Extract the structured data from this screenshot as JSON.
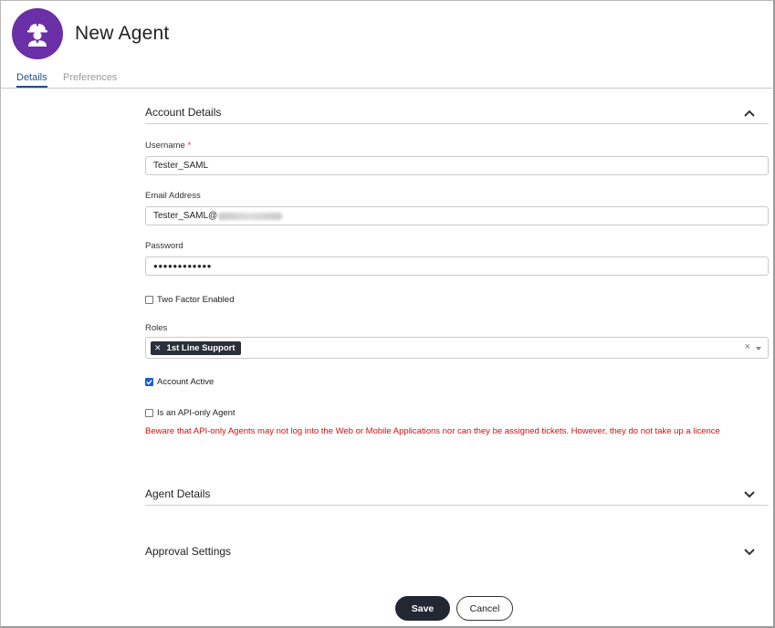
{
  "header": {
    "title": "New Agent",
    "avatar_icon": "agent-hardhat-icon",
    "avatar_color": "#6b2fa8"
  },
  "tabs": [
    {
      "label": "Details",
      "active": true
    },
    {
      "label": "Preferences",
      "active": false
    }
  ],
  "account_details": {
    "section_label": "Account Details",
    "username": {
      "label": "Username",
      "required_mark": "*",
      "value": "Tester_SAML"
    },
    "email": {
      "label": "Email Address",
      "value": "Tester_SAML@"
    },
    "password": {
      "label": "Password",
      "value": "●●●●●●●●●●●●"
    },
    "two_factor": {
      "label": "Two Factor Enabled",
      "checked": false
    },
    "roles": {
      "label": "Roles",
      "chips": [
        "1st Line Support"
      ],
      "clear_glyph": "×"
    },
    "account_active": {
      "label": "Account Active",
      "checked": true
    },
    "api_only": {
      "label": "Is an API-only Agent",
      "checked": false
    },
    "warning": "Beware that API-only Agents may not log into the Web or Mobile Applications nor can they be assigned tickets. However, they do not take up a licence"
  },
  "sections": {
    "agent_details": "Agent Details",
    "approval_settings": "Approval Settings"
  },
  "buttons": {
    "save": "Save",
    "cancel": "Cancel"
  },
  "colors": {
    "accent": "#1f4f8a",
    "warning": "#d01010",
    "primary_button": "#232733",
    "checkbox": "#1a5fd0"
  }
}
